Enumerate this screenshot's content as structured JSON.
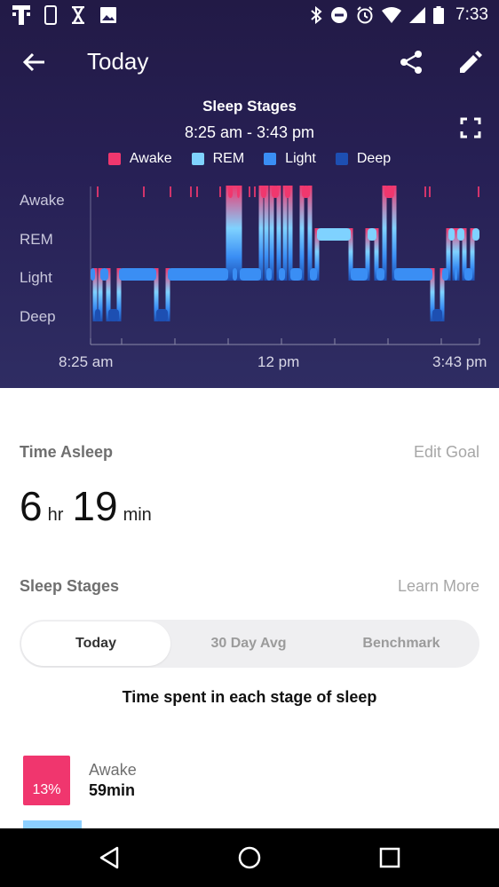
{
  "status_bar": {
    "time": "7:33",
    "left_icons": [
      "t-mobile-icon",
      "phone-icon",
      "hourglass-icon",
      "image-icon"
    ],
    "right_icons": [
      "bluetooth-icon",
      "do-not-disturb-icon",
      "alarm-icon",
      "wifi-icon",
      "signal-icon",
      "battery-icon"
    ]
  },
  "app_bar": {
    "title": "Today"
  },
  "chart": {
    "title": "Sleep Stages",
    "time_range": "8:25 am - 3:43 pm",
    "y_labels": [
      "Awake",
      "REM",
      "Light",
      "Deep"
    ],
    "x_labels": [
      "8:25 am",
      "12 pm",
      "3:43 pm"
    ]
  },
  "chart_data": {
    "type": "hypnogram",
    "title": "Sleep Stages",
    "subtitle": "8:25 am - 3:43 pm",
    "legend": [
      {
        "name": "Awake",
        "color": "#f0376e"
      },
      {
        "name": "REM",
        "color": "#7fd2ff"
      },
      {
        "name": "Light",
        "color": "#3a8ef4"
      },
      {
        "name": "Deep",
        "color": "#1d4fb2"
      }
    ],
    "stages": [
      "Deep",
      "Light",
      "REM",
      "Awake"
    ],
    "x_range": [
      "8:25",
      "15:43"
    ],
    "x_labels": [
      "8:25 am",
      "12 pm",
      "3:43 pm"
    ],
    "segments": [
      {
        "start": "8:25",
        "end": "8:30",
        "stage": "Light"
      },
      {
        "start": "8:30",
        "end": "8:36",
        "stage": "Deep"
      },
      {
        "start": "8:36",
        "end": "8:45",
        "stage": "Light"
      },
      {
        "start": "8:45",
        "end": "8:57",
        "stage": "Deep"
      },
      {
        "start": "8:57",
        "end": "9:39",
        "stage": "Light"
      },
      {
        "start": "9:39",
        "end": "9:52",
        "stage": "Deep"
      },
      {
        "start": "9:52",
        "end": "11:00",
        "stage": "Light"
      },
      {
        "start": "11:00",
        "end": "11:05",
        "stage": "Awake"
      },
      {
        "start": "11:05",
        "end": "11:10",
        "stage": "Light"
      },
      {
        "start": "11:10",
        "end": "11:13",
        "stage": "Awake"
      },
      {
        "start": "11:13",
        "end": "11:37",
        "stage": "Light"
      },
      {
        "start": "11:37",
        "end": "11:43",
        "stage": "Awake"
      },
      {
        "start": "11:43",
        "end": "11:49",
        "stage": "Light"
      },
      {
        "start": "11:49",
        "end": "11:57",
        "stage": "Awake"
      },
      {
        "start": "11:57",
        "end": "12:04",
        "stage": "Light"
      },
      {
        "start": "12:04",
        "end": "12:10",
        "stage": "Awake"
      },
      {
        "start": "12:10",
        "end": "12:23",
        "stage": "Light"
      },
      {
        "start": "12:23",
        "end": "12:32",
        "stage": "Awake"
      },
      {
        "start": "12:32",
        "end": "12:40",
        "stage": "Light"
      },
      {
        "start": "12:40",
        "end": "13:18",
        "stage": "REM"
      },
      {
        "start": "13:18",
        "end": "13:37",
        "stage": "Light"
      },
      {
        "start": "13:37",
        "end": "13:47",
        "stage": "REM"
      },
      {
        "start": "13:47",
        "end": "13:56",
        "stage": "Light"
      },
      {
        "start": "13:56",
        "end": "14:07",
        "stage": "Awake"
      },
      {
        "start": "14:07",
        "end": "14:50",
        "stage": "Light"
      },
      {
        "start": "14:50",
        "end": "15:01",
        "stage": "Deep"
      },
      {
        "start": "15:01",
        "end": "15:08",
        "stage": "Light"
      },
      {
        "start": "15:08",
        "end": "15:15",
        "stage": "REM"
      },
      {
        "start": "15:15",
        "end": "15:18",
        "stage": "Light"
      },
      {
        "start": "15:18",
        "end": "15:26",
        "stage": "REM"
      },
      {
        "start": "15:26",
        "end": "15:35",
        "stage": "Light"
      },
      {
        "start": "15:35",
        "end": "15:43",
        "stage": "REM"
      }
    ],
    "brief_wakes": [
      "8:33",
      "9:25",
      "9:55",
      "10:18",
      "10:25",
      "10:51",
      "11:24",
      "11:30",
      "14:42",
      "14:47",
      "15:42"
    ]
  },
  "summary": {
    "title": "Time Asleep",
    "edit_goal": "Edit Goal",
    "hours": "6",
    "hours_unit": "hr",
    "minutes": "19",
    "minutes_unit": "min"
  },
  "stages_section": {
    "title": "Sleep Stages",
    "learn_more": "Learn More",
    "tabs": [
      "Today",
      "30 Day Avg",
      "Benchmark"
    ],
    "active_tab": "Today",
    "subtitle": "Time spent in each stage of sleep",
    "rows": [
      {
        "name": "Awake",
        "percent": "13%",
        "duration": "59min",
        "color": "#f0366e"
      }
    ]
  },
  "nav_bar": {
    "icons": [
      "back-triangle-icon",
      "home-circle-icon",
      "recents-square-icon"
    ]
  }
}
